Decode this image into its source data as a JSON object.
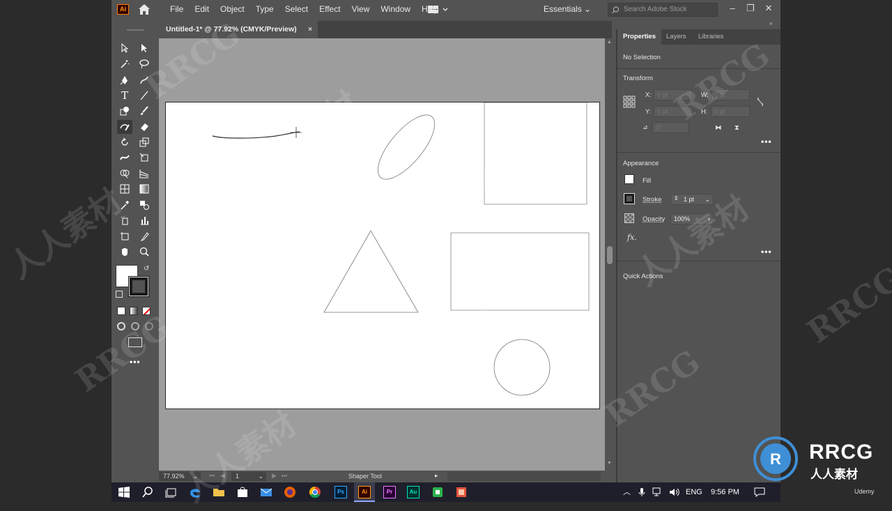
{
  "app": {
    "logo_text": "Ai",
    "menu": [
      "File",
      "Edit",
      "Object",
      "Type",
      "Select",
      "Effect",
      "View",
      "Window",
      "Help"
    ],
    "workspace": "Essentials",
    "search_placeholder": "Search Adobe Stock"
  },
  "document": {
    "tab_title": "Untitled-1* @ 77.92% (CMYK/Preview)",
    "close_glyph": "×"
  },
  "status": {
    "zoom": "77.92%",
    "artboard_number": "1",
    "current_tool": "Shaper Tool"
  },
  "panel": {
    "tabs": [
      "Properties",
      "Layers",
      "Libraries"
    ],
    "selection": "No Selection",
    "transform_title": "Transform",
    "x_label": "X:",
    "x_value": "0 pt",
    "y_label": "Y:",
    "y_value": "0 pt",
    "w_label": "W:",
    "w_value": "0 pt",
    "h_label": "H:",
    "h_value": "0 pt",
    "angle_value": "0°",
    "appearance_title": "Appearance",
    "fill_label": "Fill",
    "stroke_label": "Stroke",
    "stroke_value": "1 pt",
    "opacity_label": "Opacity",
    "opacity_value": "100%",
    "fx_label": "fx.",
    "quick_actions_title": "Quick Actions",
    "more": "•••"
  },
  "taskbar": {
    "lang": "ENG",
    "time": "9:56 PM",
    "apps": [
      "Ps",
      "Ai",
      "Pr",
      "Au"
    ]
  },
  "watermarks": {
    "rrcg": "RRCG",
    "cn": "人人素材",
    "brand": "Udemy"
  },
  "colors": {
    "ui_bg": "#535353",
    "accent_ai": "#ff9a00",
    "artboard": "#ffffff"
  }
}
